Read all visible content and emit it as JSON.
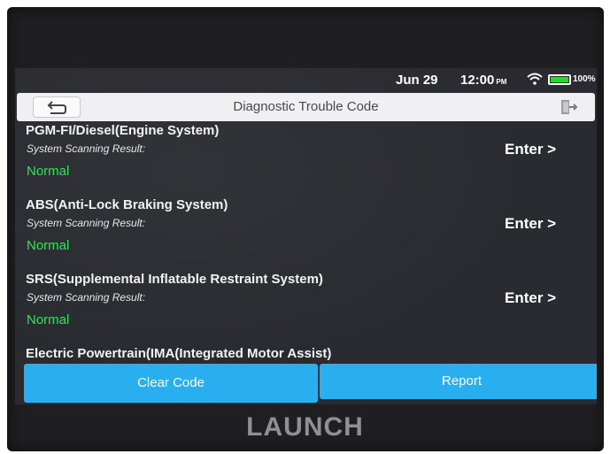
{
  "status_bar": {
    "date": "Jun 29",
    "time": "12:00",
    "ampm": "PM",
    "battery_percent": "100%",
    "battery_level": 1.0,
    "icons": [
      "wifi-icon",
      "battery-icon"
    ]
  },
  "header": {
    "title": "Diagnostic Trouble Code",
    "back_icon": "back-arrow-icon",
    "exit_icon": "exit-icon"
  },
  "systems": [
    {
      "name": "PGM-FI/Diesel(Engine System)",
      "subtitle": "System Scanning Result:",
      "status": "Normal",
      "enter_label": "Enter >"
    },
    {
      "name": "ABS(Anti-Lock Braking System)",
      "subtitle": "System Scanning Result:",
      "status": "Normal",
      "enter_label": "Enter >"
    },
    {
      "name": "SRS(Supplemental Inflatable Restraint System)",
      "subtitle": "System Scanning Result:",
      "status": "Normal",
      "enter_label": "Enter >"
    },
    {
      "name": "Electric Powertrain(IMA(Integrated Motor Assist)",
      "subtitle": "",
      "status": "",
      "enter_label": ""
    }
  ],
  "footer": {
    "clear_label": "Clear Code",
    "report_label": "Report"
  },
  "brand": "LAUNCH",
  "colors": {
    "accent_button": "#29aef0",
    "status_normal": "#2ee65a",
    "screen_bg": "#2a2b30"
  }
}
